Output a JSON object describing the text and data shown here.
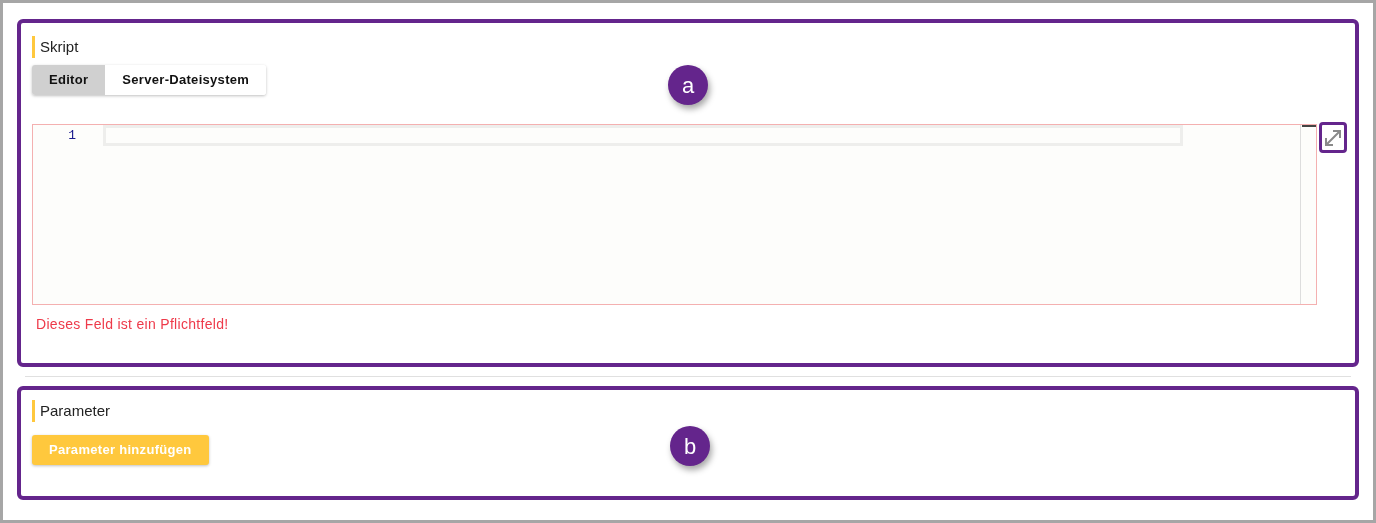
{
  "sections": [
    {
      "kind": "script",
      "title": "Skript",
      "callout": "a",
      "tabs": [
        {
          "label": "Editor",
          "selected": true
        },
        {
          "label": "Server-Dateisystem",
          "selected": false
        }
      ],
      "editor": {
        "line_numbers": [
          "1"
        ],
        "invalid": true
      },
      "error": "Dieses Feld ist ein Pflichtfeld!"
    },
    {
      "kind": "params",
      "title": "Parameter",
      "callout": "b",
      "button": "Parameter hinzufügen"
    }
  ]
}
